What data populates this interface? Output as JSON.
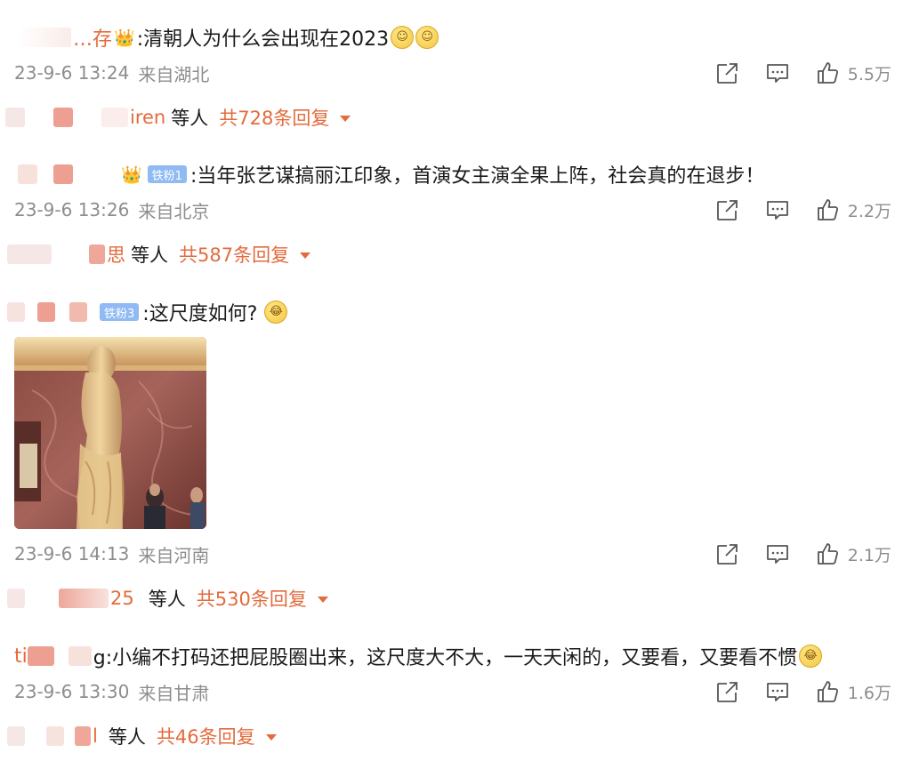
{
  "comments": [
    {
      "user": "…存",
      "text": ":清朝人为什么会出现在2023",
      "emoji_count": 2,
      "time": "23-9-6 13:24",
      "location": "来自湖北",
      "likes": "5.5万",
      "reply_name": "iren",
      "reply_etc": "等人",
      "reply_count": "共728条回复"
    },
    {
      "user": "",
      "fan_badge": "铁粉1",
      "text": ":当年张艺谋搞丽江印象，首演女主演全果上阵，社会真的在退步！",
      "time": "23-9-6 13:26",
      "location": "来自北京",
      "likes": "2.2万",
      "reply_name": "思",
      "reply_etc": "等人",
      "reply_count": "共587条回复"
    },
    {
      "user": "",
      "fan_badge": "铁粉3",
      "text": ":这尺度如何?",
      "time": "23-9-6 14:13",
      "location": "来自河南",
      "likes": "2.1万",
      "reply_name": "25",
      "reply_etc": "等人",
      "reply_count": "共530条回复"
    },
    {
      "user": "ti",
      "text": "g:小编不打码还把屁股圈出来，这尺度大不大，一天天闲的，又要看，又要看不惯",
      "time": "23-9-6 13:30",
      "location": "来自甘肃",
      "likes": "1.6万",
      "reply_name": "l",
      "reply_etc": "等人",
      "reply_count": "共46条回复"
    }
  ],
  "icons": {
    "share": "share-icon",
    "comment": "comment-icon",
    "like": "thumbs-up-icon",
    "expand": "chevron-down-icon"
  },
  "colors": {
    "accent": "#e36b3d",
    "meta": "#8d8d8d",
    "badge": "#8fbaf3"
  }
}
